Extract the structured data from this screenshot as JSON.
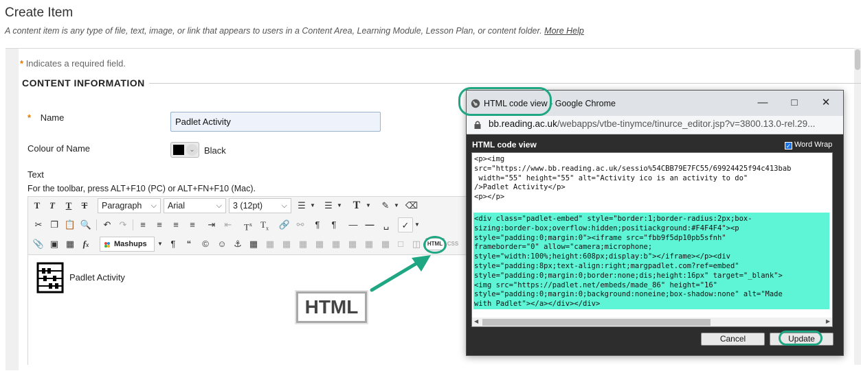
{
  "page": {
    "title": "Create Item",
    "description": "A content item is any type of file, text, image, or link that appears to users in a Content Area, Learning Module, Lesson Plan, or content folder.",
    "more_help": "More Help"
  },
  "form": {
    "required_star": "*",
    "required_note": "Indicates a required field.",
    "section_title": "CONTENT INFORMATION",
    "name_label": "Name",
    "name_value": "Padlet Activity",
    "colour_label": "Colour of Name",
    "colour_value": "Black",
    "text_label": "Text",
    "toolbar_hint": "For the toolbar, press ALT+F10 (PC) or ALT+FN+F10 (Mac)."
  },
  "toolbar": {
    "format_select": "Paragraph",
    "font_select": "Arial",
    "size_select": "3 (12pt)",
    "mashups": "Mashups",
    "html_button": "HTML",
    "css_button": "CSS"
  },
  "editor": {
    "item_text": "Padlet Activity"
  },
  "callout": {
    "text": "HTML"
  },
  "popup": {
    "window_title": "HTML code view - Google Chrome",
    "url_host": "bb.reading.ac.uk",
    "url_path": "/webapps/vtbe-tinymce/tinurce_editor.jsp?v=3800.13.0-rel.29...",
    "dialog_title": "HTML code view",
    "word_wrap": "Word Wrap",
    "code_top": "<p><img\nsrc=\"https://www.bb.reading.ac.uk/sessio%54CBB79E7FC55/69924425f94c413bab\n width=\"55\" height=\"55\" alt=\"Activity ico is an activity to do\"\n/>Padlet Activity</p>\n<p></p>",
    "code_selected": "<div class=\"padlet-embed\" style=\"border:1;border-radius:2px;box-\nsizing:border-box;overflow:hidden;positiackground:#F4F4F4\"><p\nstyle=\"padding:0;margin:0\"><iframe src=\"fbb9f5dp10pb5sfnh\"\nframeborder=\"0\" allow=\"camera;microphone;\nstyle=\"width:100%;height:608px;display:b\"></iframe></p><div\nstyle=\"padding:8px;text-align:right;margpadlet.com?ref=embed\"\nstyle=\"padding:0;margin:0;border:none;dis;height:16px\" target=\"_blank\">\n<img src=\"https://padlet.net/embeds/made_86\" height=\"16\"\nstyle=\"padding:0;margin:0;background:noneine;box-shadow:none\" alt=\"Made\nwith Padlet\"></a></div></div>",
    "cancel": "Cancel",
    "update": "Update"
  },
  "colors": {
    "highlight": "#1fa784",
    "selection": "#5ef5d6",
    "required": "#e07b00"
  }
}
